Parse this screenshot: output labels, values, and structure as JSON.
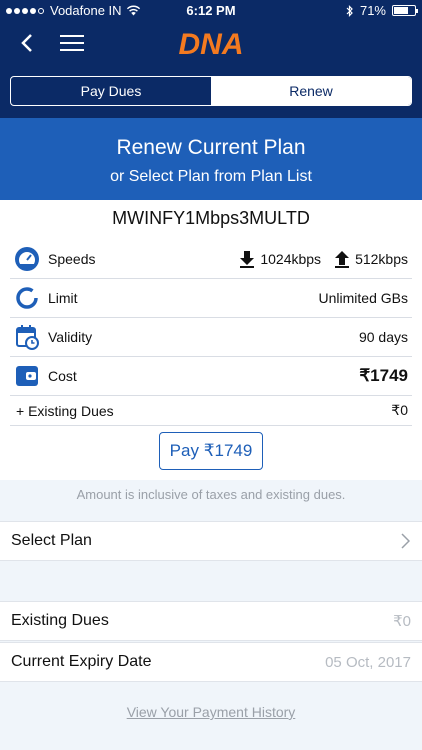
{
  "status_bar": {
    "carrier": "Vodafone IN",
    "time": "6:12 PM",
    "battery_percent": "71%",
    "battery_level": 0.71
  },
  "nav": {
    "logo_text": "DNA",
    "icons": [
      "back-chevron-icon",
      "hamburger-menu-icon"
    ]
  },
  "segmented": {
    "tabs": [
      "Pay Dues",
      "Renew"
    ],
    "selected": "Renew"
  },
  "banner": {
    "title": "Renew Current Plan",
    "subtitle": "or Select Plan from Plan List"
  },
  "plan": {
    "name": "MWINFY1Mbps3MULTD",
    "speeds_label": "Speeds",
    "download": "1024kbps",
    "upload": "512kbps",
    "limit_label": "Limit",
    "limit_value": "Unlimited GBs",
    "validity_label": "Validity",
    "validity_value": "90 days",
    "cost_label": "Cost",
    "cost_value": "₹1749",
    "existing_dues_label": "+ Existing Dues",
    "existing_dues_value": "₹0"
  },
  "pay_button": "Pay ₹1749",
  "note": "Amount is inclusive of taxes and existing dues.",
  "select_plan_label": "Select Plan",
  "existing_dues": {
    "label": "Existing Dues",
    "value": "₹0"
  },
  "expiry": {
    "label": "Current Expiry Date",
    "value": "05 Oct, 2017"
  },
  "history_link": "View Your Payment History",
  "colors": {
    "nav_bg": "#0b2a66",
    "banner_bg": "#1e5fb8",
    "accent": "#1e5fb8",
    "logo_orange": "#f47a20"
  }
}
